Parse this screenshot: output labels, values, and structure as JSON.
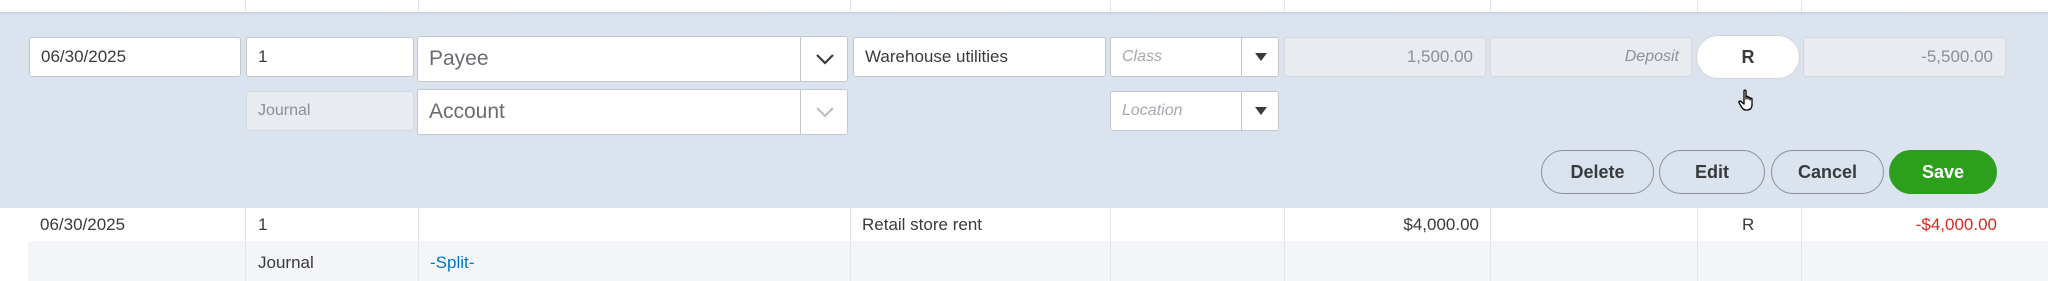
{
  "edit_row": {
    "date": "06/30/2025",
    "ref_no": "1",
    "payee_placeholder": "Payee",
    "type": "Journal",
    "account_placeholder": "Account",
    "memo": "Warehouse utilities",
    "class_placeholder": "Class",
    "location_placeholder": "Location",
    "payment": "1,500.00",
    "deposit_placeholder": "Deposit",
    "reconcile_status": "R",
    "balance": "-5,500.00"
  },
  "actions": {
    "delete": "Delete",
    "edit": "Edit",
    "cancel": "Cancel",
    "save": "Save"
  },
  "transactions": [
    {
      "date": "06/30/2025",
      "ref_no": "1",
      "type": "Journal",
      "payee": "",
      "account": "-Split-",
      "memo": "Retail store rent",
      "payment": "$4,000.00",
      "reconcile_status": "R",
      "balance": "-$4,000.00"
    }
  ],
  "colors": {
    "edit_panel_bg": "#dbe4ee",
    "save_green": "#2ca01c",
    "negative_red": "#d52b1e",
    "link_blue": "#0077c5"
  }
}
